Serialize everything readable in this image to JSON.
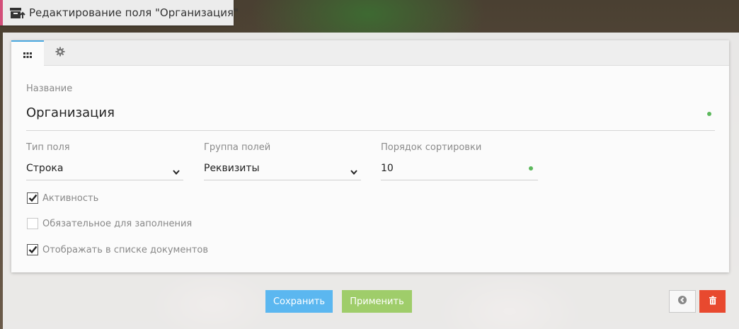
{
  "window": {
    "title": "Редактирование поля \"Организация\"",
    "icon": "archive-upload-icon"
  },
  "tabs": [
    {
      "icon": "grid-icon",
      "active": true
    },
    {
      "icon": "gear-icon",
      "active": false
    }
  ],
  "form": {
    "name_label": "Название",
    "name_value": "Организация",
    "field_type_label": "Тип поля",
    "field_type_value": "Строка",
    "field_group_label": "Группа полей",
    "field_group_value": "Реквизиты",
    "sort_order_label": "Порядок сортировки",
    "sort_order_value": "10",
    "checkboxes": [
      {
        "label": "Активность",
        "checked": true
      },
      {
        "label": "Обязательное для заполнения",
        "checked": false
      },
      {
        "label": "Отображать в списке документов",
        "checked": true
      }
    ]
  },
  "buttons": {
    "save": "Сохранить",
    "apply": "Применить",
    "back_icon": "back-arrow-icon",
    "delete_icon": "trash-icon"
  },
  "colors": {
    "accent": "#4aa8e0",
    "save": "#5bb7f0",
    "apply": "#9fcd6a",
    "delete": "#e8492f",
    "status_dot": "#5cb85c"
  }
}
